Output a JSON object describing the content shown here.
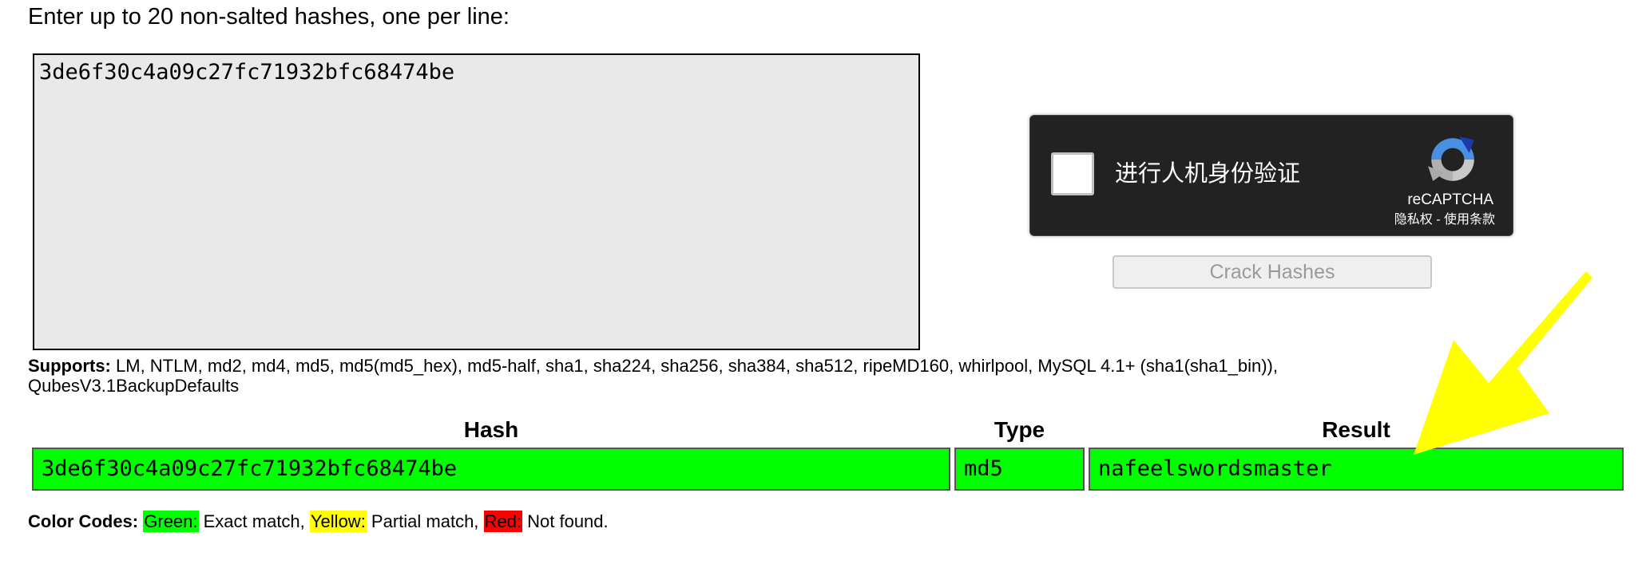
{
  "instructions": "Enter up to 20 non-salted hashes, one per line:",
  "textarea": {
    "value": "3de6f30c4a09c27fc71932bfc68474be"
  },
  "recaptcha": {
    "label": "进行人机身份验证",
    "brand": "reCAPTCHA",
    "privacy": "隐私权",
    "separator": " - ",
    "terms": "使用条款",
    "logo_icon": "recaptcha-logo-icon"
  },
  "crack_button": {
    "label": "Crack Hashes"
  },
  "supports": {
    "label": "Supports:",
    "text": " LM, NTLM, md2, md4, md5, md5(md5_hex), md5-half, sha1, sha224, sha256, sha384, sha512, ripeMD160, whirlpool, MySQL 4.1+ (sha1(sha1_bin)), QubesV3.1BackupDefaults"
  },
  "results_table": {
    "headers": {
      "hash": "Hash",
      "type": "Type",
      "result": "Result"
    },
    "rows": [
      {
        "hash": "3de6f30c4a09c27fc71932bfc68474be",
        "type": "md5",
        "result": "nafeelswordsmaster",
        "status_color": "#00ff00"
      }
    ]
  },
  "color_codes": {
    "label": "Color Codes:",
    "green": {
      "name": "Green:",
      "desc": " Exact match, ",
      "color": "#00ff00"
    },
    "yellow": {
      "name": "Yellow:",
      "desc": " Partial match, ",
      "color": "#ffff00"
    },
    "red": {
      "name": "Red:",
      "desc": " Not found.",
      "color": "#ff0000"
    }
  },
  "annotation": {
    "arrow_color": "#ffff00",
    "arrow_icon": "arrow-icon"
  }
}
